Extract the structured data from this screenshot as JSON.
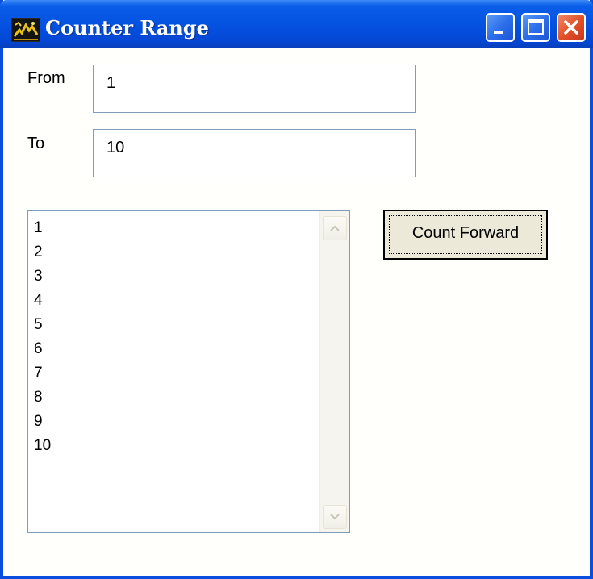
{
  "window": {
    "title": "Counter Range",
    "icon": "app-icon",
    "controls": [
      "minimize-icon",
      "maximize-icon",
      "close-icon"
    ],
    "colors": {
      "titlebar": "#0552e1",
      "frame": "#0a4ee0",
      "close_button": "#e2522a",
      "background": "#fffffb"
    }
  },
  "form": {
    "from_label": "From",
    "from_value": "1",
    "to_label": "To",
    "to_value": "10"
  },
  "list": {
    "items": [
      "1",
      "2",
      "3",
      "4",
      "5",
      "6",
      "7",
      "8",
      "9",
      "10"
    ]
  },
  "button": {
    "label": "Count Forward"
  }
}
